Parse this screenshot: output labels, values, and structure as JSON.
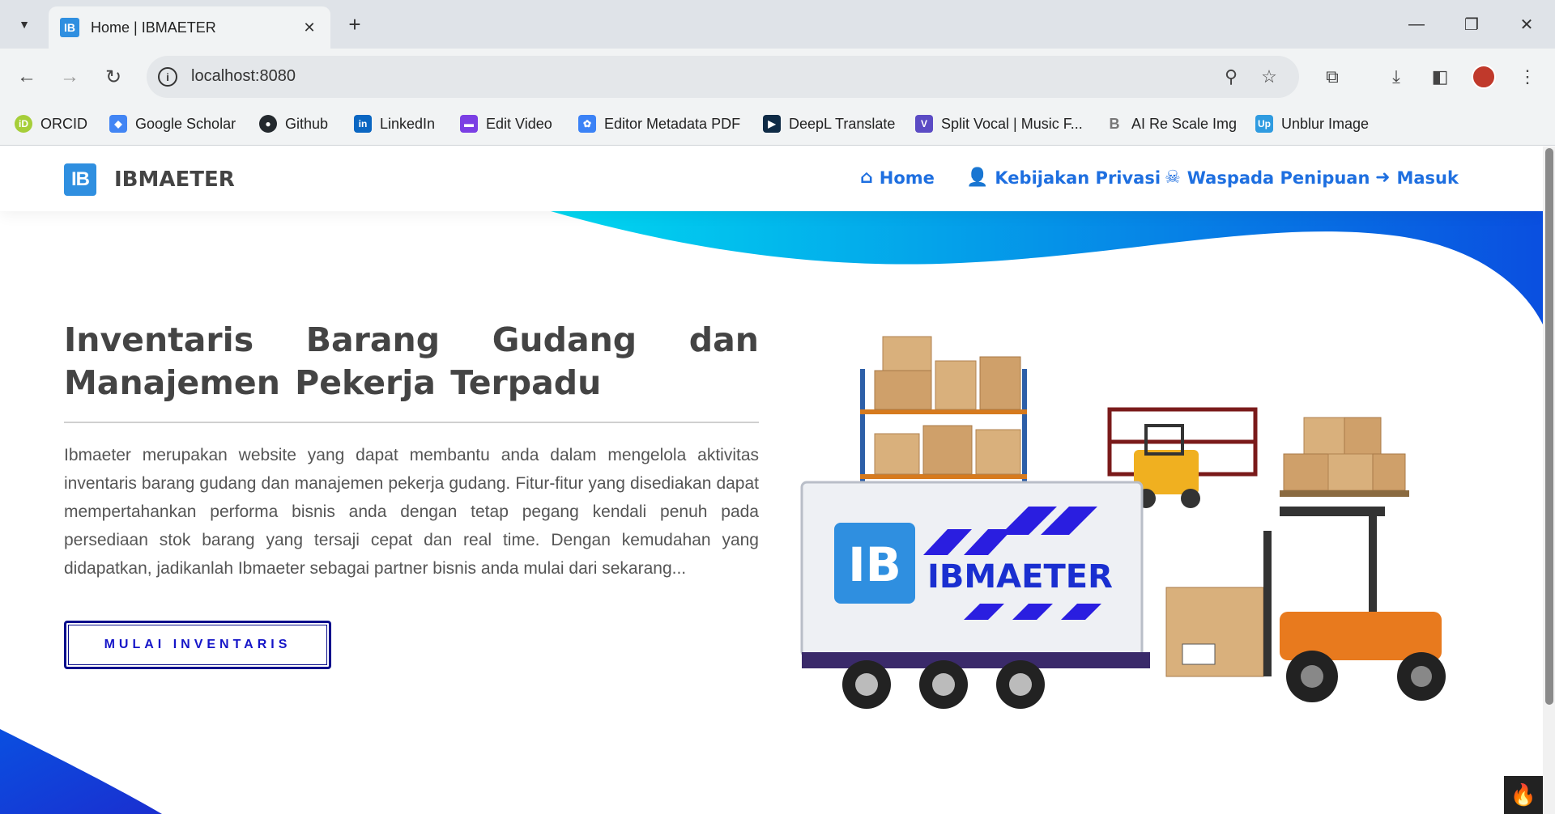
{
  "browser": {
    "tab": {
      "favicon_text": "IB",
      "title": "Home | IBMAETER"
    },
    "address": {
      "url": "localhost:8080"
    },
    "bookmarks": [
      {
        "label": "ORCID",
        "color": "#a6ce39",
        "glyph": "iD"
      },
      {
        "label": "Google Scholar",
        "color": "#4285f4",
        "glyph": "◆"
      },
      {
        "label": "Github",
        "color": "#24292e",
        "glyph": "●"
      },
      {
        "label": "LinkedIn",
        "color": "#0a66c2",
        "glyph": "in"
      },
      {
        "label": "Edit Video",
        "color": "#7b3fe4",
        "glyph": "▬"
      },
      {
        "label": "Editor Metadata PDF",
        "color": "#3b82f6",
        "glyph": "✿"
      },
      {
        "label": "DeepL Translate",
        "color": "#0f2b46",
        "glyph": "▶"
      },
      {
        "label": "Split Vocal | Music F...",
        "color": "#5b4bc4",
        "glyph": "V"
      },
      {
        "label": "AI Re Scale Img",
        "color": "#888888",
        "glyph": "B"
      },
      {
        "label": "Unblur Image",
        "color": "#2f9be0",
        "glyph": "Up"
      }
    ]
  },
  "site": {
    "brand": {
      "logo_text": "IB",
      "name": "IBMAETER"
    },
    "nav": [
      {
        "label": "Home",
        "icon": "home-icon"
      },
      {
        "label": "Kebijakan Privasi",
        "icon": "user-shield-icon"
      },
      {
        "label": "Waspada Penipuan",
        "icon": "skull-icon"
      },
      {
        "label": "Masuk",
        "icon": "sign-in-icon"
      }
    ],
    "hero": {
      "title": "Inventaris Barang Gudang dan Manajemen Pekerja Terpadu",
      "description": "Ibmaeter merupakan website yang dapat membantu anda dalam mengelola aktivitas inventaris barang gudang dan manajemen pekerja gudang. Fitur-fitur yang disediakan dapat mempertahankan performa bisnis anda dengan tetap pegang kendali penuh pada persediaan stok barang yang tersaji cepat dan real time. Dengan kemudahan yang didapatkan, jadikanlah Ibmaeter sebagai partner bisnis anda mulai dari sekarang...",
      "cta_label": "MULAI INVENTARIS"
    },
    "illustration": {
      "truck_logo_text": "IB",
      "truck_brand_text": "IBMAETER"
    },
    "colors": {
      "accent": "#1e6fe0",
      "wave_start": "#00d8f0",
      "wave_end": "#0a4fe0",
      "cta_border": "#0a0f8c"
    }
  }
}
